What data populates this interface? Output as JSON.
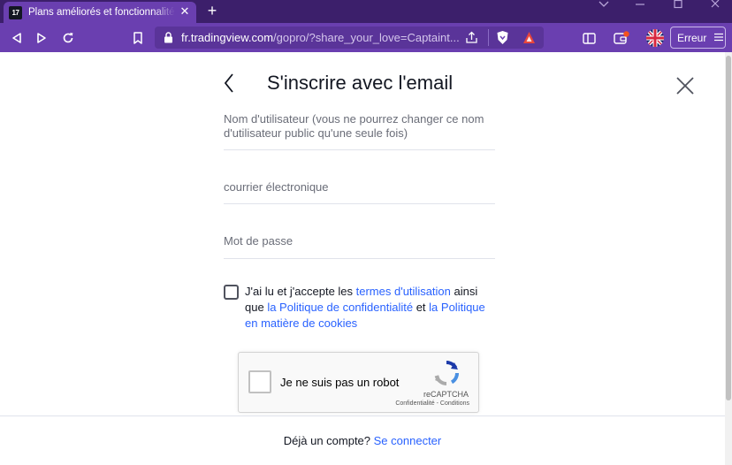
{
  "browser": {
    "tab": {
      "favicon_text": "17",
      "title": "Plans améliorés et fonctionnalités",
      "close_glyph": "✕"
    },
    "new_tab_glyph": "+",
    "address": {
      "domain": "fr.tradingview.com",
      "path": "/gopro/?share_your_love=Captaint..."
    },
    "profile_button": {
      "label": "Erreur"
    },
    "colors": {
      "tabbar": "#3c1f6b",
      "toolbar": "#6a3fb0",
      "urlbar": "#5a3499"
    }
  },
  "modal": {
    "title": "S'inscrire avec l'email",
    "fields": {
      "username_placeholder": "Nom d'utilisateur (vous ne pourrez changer ce nom d'utilisateur public qu'une seule fois)",
      "email_placeholder": "courrier électronique",
      "password_placeholder": "Mot de passe"
    },
    "terms": {
      "prefix": "J'ai lu et j'accepte les ",
      "terms_link": "termes d'utilisation",
      "mid1": " ainsi que ",
      "privacy_link": "la Politique de confidentialité",
      "mid2": " et ",
      "cookies_link": "la Politique en matière de cookies",
      "checked": false
    },
    "recaptcha": {
      "label": "Je ne suis pas un robot",
      "brand": "reCAPTCHA",
      "links": "Confidentialité - Conditions",
      "checked": false
    },
    "footer": {
      "text": "Déjà un compte? ",
      "link": "Se connecter"
    },
    "colors": {
      "link": "#2962ff",
      "text": "#131722",
      "placeholder": "#6a6d78"
    }
  }
}
